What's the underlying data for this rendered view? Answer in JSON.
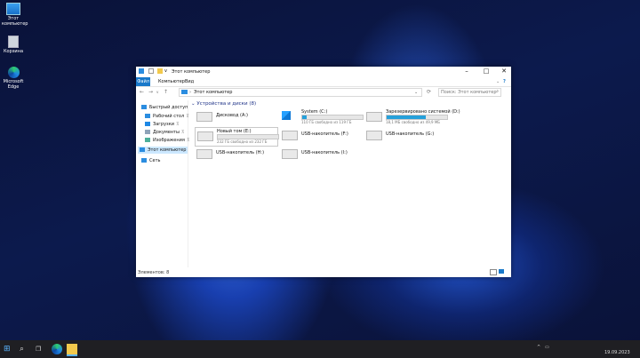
{
  "desktop": {
    "icons": [
      {
        "label": "Этот компьютер"
      },
      {
        "label": "Корзина"
      },
      {
        "label": "Microsoft Edge"
      }
    ]
  },
  "window": {
    "title": "Этот компьютер",
    "tabs": [
      "Файл",
      "Компьютер",
      "Вид"
    ],
    "address": "Этот компьютер",
    "search_placeholder": "Поиск: Этот компьютер",
    "nav": {
      "quick_access": "Быстрый доступ",
      "items": [
        "Рабочий стол",
        "Загрузки",
        "Документы",
        "Изображения"
      ],
      "this_pc": "Этот компьютер",
      "network": "Сеть"
    },
    "group": "Устройства и диски (8)",
    "drives": [
      {
        "name": "Дисковод (A:)",
        "free": "",
        "used": null
      },
      {
        "name": "System (C:)",
        "free": "110 ГБ свободно из 119 ГБ",
        "used": 0.08
      },
      {
        "name": "Зарезервировано системой (D:)",
        "free": "18,1 МБ свободно из 49,9 МБ",
        "used": 0.64
      },
      {
        "name": "Новый том (E:)",
        "free": "232 ГБ свободно из 232 ГБ",
        "used": 0.0
      },
      {
        "name": "USB-накопитель (F:)",
        "free": "",
        "used": null
      },
      {
        "name": "USB-накопитель (G:)",
        "free": "",
        "used": null
      },
      {
        "name": "USB-накопитель (H:)",
        "free": "",
        "used": null
      },
      {
        "name": "USB-накопитель (I:)",
        "free": "",
        "used": null
      }
    ],
    "status": "Элементов: 8"
  },
  "taskbar": {
    "time": "19.09.2023"
  },
  "colors": {
    "accent": "#1979ca",
    "bar_fill": "#26a0da"
  }
}
